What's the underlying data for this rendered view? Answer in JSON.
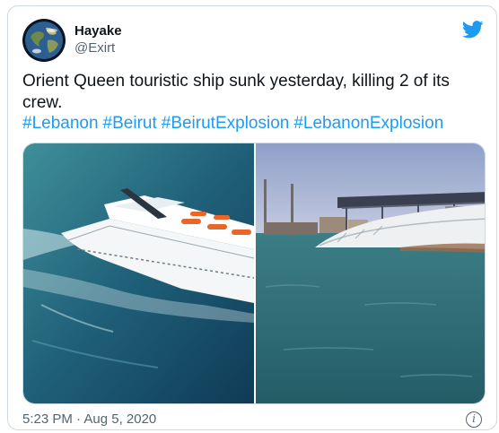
{
  "tweet": {
    "author_name": "Hayake",
    "author_handle": "@Exirt",
    "text": "Orient Queen touristic ship sunk yesterday, killing 2 of its crew.",
    "hashtags": [
      "#Lebanon",
      "#Beirut",
      "#BeirutExplosion",
      "#LebanonExplosion"
    ],
    "timestamp": "5:23 PM · Aug 5, 2020",
    "info_glyph": "i"
  },
  "icons": {
    "brand": "twitter-bird-icon",
    "info": "info-icon",
    "avatar": "earth-globe-avatar"
  },
  "colors": {
    "link": "#1d9bf0",
    "secondary_text": "#536471",
    "border": "#cfd9de"
  }
}
